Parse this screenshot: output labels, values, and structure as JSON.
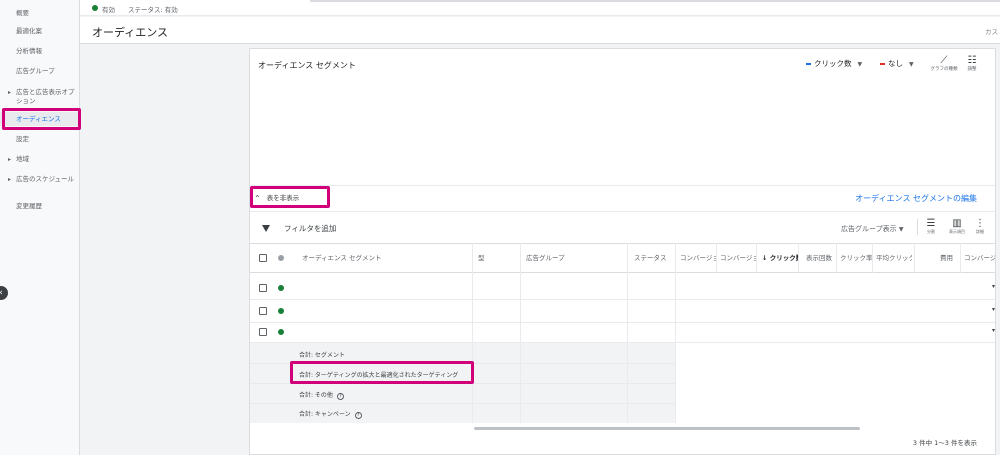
{
  "sidebar": {
    "items": [
      {
        "label": "概要",
        "arrow": false
      },
      {
        "label": "最適化案",
        "arrow": false
      },
      {
        "label": "分析情報",
        "arrow": false
      },
      {
        "label": "広告グループ",
        "arrow": false
      },
      {
        "label": "広告と広告表示オプション",
        "arrow": true
      },
      {
        "label": "オーディエンス",
        "arrow": false,
        "selected": true
      },
      {
        "label": "設定",
        "arrow": false
      },
      {
        "label": "地域",
        "arrow": true
      },
      {
        "label": "広告のスケジュール",
        "arrow": true
      },
      {
        "label": "変更履歴",
        "arrow": false
      }
    ],
    "collapse_glyph": "‹"
  },
  "topbar": {
    "status": "有効",
    "campaign_status": "ステータス: 有効"
  },
  "page": {
    "title": "オーディエンス",
    "right_text": "カス"
  },
  "card": {
    "title": "オーディエンス セグメント",
    "metric1": {
      "label": "クリック数",
      "color": "#1a73e8"
    },
    "metric2": {
      "label": "なし",
      "color": "#d93025"
    },
    "chart_type_label": "グラフの種類",
    "adjust_label": "調整",
    "toggle_label": "表を非表示",
    "edit_link": "オーディエンス セグメントの編集",
    "filter_label": "フィルタを追加",
    "group_view": "広告グループ表示",
    "segment_label": "分割",
    "columns_label": "表示項目",
    "detail_label": "詳細"
  },
  "table": {
    "headers": [
      "オーディエンス セグメント",
      "型",
      "広告グループ",
      "ステータス",
      "コンバージョン",
      "コンバージョン",
      "クリック数",
      "表示回数",
      "クリック率",
      "平均クリック単価",
      "費用",
      "コンバージョン"
    ],
    "sort_glyph": "↓",
    "rows": 3,
    "totals": [
      {
        "label": "合計: セグメント",
        "help": false
      },
      {
        "label": "合計: ターゲティングの拡大と最適化されたターゲティング",
        "help": false
      },
      {
        "label": "合計: その他",
        "help": true
      },
      {
        "label": "合計: キャンペーン",
        "help": true
      }
    ],
    "help_glyph": "?",
    "pager": "3 件中 1～3 件を表示"
  },
  "colors": {
    "highlight": "#d1007a",
    "accent": "#1a73e8",
    "active": "#188038"
  }
}
